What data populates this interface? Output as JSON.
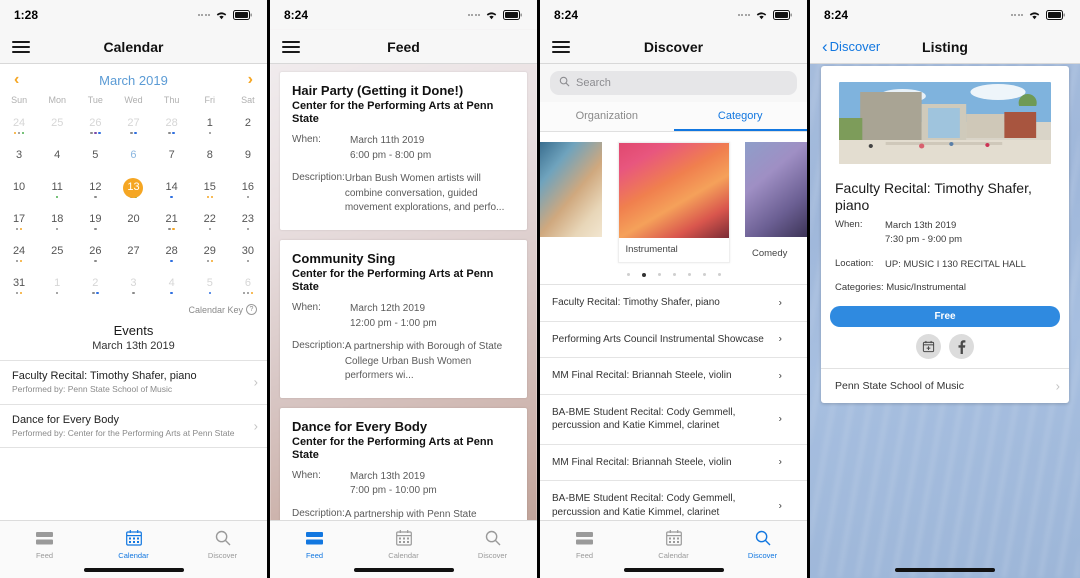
{
  "calendar_screen": {
    "status": {
      "time": "1:28"
    },
    "nav": {
      "title": "Calendar",
      "menu_icon": "hamburger-icon"
    },
    "month_label": "March 2019",
    "prev_icon": "chevron-left-icon",
    "next_icon": "chevron-right-icon",
    "weekdays": [
      "Sun",
      "Mon",
      "Tue",
      "Wed",
      "Thu",
      "Fri",
      "Sat"
    ],
    "days": [
      {
        "n": "24",
        "dim": true,
        "dots": [
          "#f5a623",
          "#8a8a8a",
          "#4caf50"
        ]
      },
      {
        "n": "25",
        "dim": true,
        "dots": []
      },
      {
        "n": "26",
        "dim": true,
        "dots": [
          "#8a8a8a",
          "#7b4ba8",
          "#2f6fe0"
        ]
      },
      {
        "n": "27",
        "dim": true,
        "dots": [
          "#8a8a8a",
          "#2f6fe0"
        ]
      },
      {
        "n": "28",
        "dim": true,
        "dots": [
          "#8a8a8a",
          "#2f6fe0"
        ]
      },
      {
        "n": "1",
        "dots": [
          "#8a8a8a"
        ]
      },
      {
        "n": "2",
        "dots": []
      },
      {
        "n": "3",
        "dots": []
      },
      {
        "n": "4",
        "dots": []
      },
      {
        "n": "5",
        "dots": []
      },
      {
        "n": "6",
        "blue": true,
        "dots": []
      },
      {
        "n": "7",
        "dots": []
      },
      {
        "n": "8",
        "dots": []
      },
      {
        "n": "9",
        "dots": []
      },
      {
        "n": "10",
        "dots": []
      },
      {
        "n": "11",
        "dots": [
          "#4caf50"
        ]
      },
      {
        "n": "12",
        "dots": [
          "#8a8a8a"
        ]
      },
      {
        "n": "13",
        "selected": true,
        "dots": [
          "#2f6fe0",
          "#4caf50"
        ]
      },
      {
        "n": "14",
        "dots": [
          "#2f6fe0"
        ]
      },
      {
        "n": "15",
        "dots": [
          "#f5a623",
          "#f5a623"
        ]
      },
      {
        "n": "16",
        "dots": [
          "#8a8a8a"
        ]
      },
      {
        "n": "17",
        "dots": [
          "#8a8a8a",
          "#f5a623"
        ]
      },
      {
        "n": "18",
        "dots": [
          "#8a8a8a"
        ]
      },
      {
        "n": "19",
        "dots": [
          "#8a8a8a"
        ]
      },
      {
        "n": "20",
        "dots": []
      },
      {
        "n": "21",
        "dots": [
          "#8a8a8a",
          "#f5a623"
        ]
      },
      {
        "n": "22",
        "dots": [
          "#8a8a8a"
        ]
      },
      {
        "n": "23",
        "dots": [
          "#8a8a8a"
        ]
      },
      {
        "n": "24",
        "dots": [
          "#8a8a8a",
          "#f5a623"
        ]
      },
      {
        "n": "25",
        "dots": []
      },
      {
        "n": "26",
        "dots": [
          "#8a8a8a"
        ]
      },
      {
        "n": "27",
        "dots": []
      },
      {
        "n": "28",
        "dots": [
          "#2f6fe0"
        ]
      },
      {
        "n": "29",
        "dots": [
          "#8a8a8a",
          "#f5a623"
        ]
      },
      {
        "n": "30",
        "dots": [
          "#8a8a8a"
        ]
      },
      {
        "n": "31",
        "dots": [
          "#8a8a8a",
          "#f5a623"
        ]
      },
      {
        "n": "1",
        "dim": true,
        "dots": [
          "#8a8a8a"
        ]
      },
      {
        "n": "2",
        "dim": true,
        "dots": [
          "#8a8a8a",
          "#2f6fe0"
        ]
      },
      {
        "n": "3",
        "dim": true,
        "dots": [
          "#8a8a8a"
        ]
      },
      {
        "n": "4",
        "dim": true,
        "dots": [
          "#2f6fe0"
        ]
      },
      {
        "n": "5",
        "dim": true,
        "dots": [
          "#2f6fe0"
        ]
      },
      {
        "n": "6",
        "dim": true,
        "dots": [
          "#8a8a8a",
          "#8a8a8a",
          "#f5a623"
        ]
      }
    ],
    "calendar_key": "Calendar Key",
    "events_header": "Events",
    "events_date": "March 13th 2019",
    "events": [
      {
        "title": "Faculty Recital: Timothy Shafer, piano",
        "subtitle": "Performed by: Penn State School of Music"
      },
      {
        "title": "Dance for Every Body",
        "subtitle": "Performed by: Center for the Performing Arts at Penn State"
      }
    ],
    "tabs": [
      {
        "label": "Feed",
        "icon": "feed-icon",
        "active": false
      },
      {
        "label": "Calendar",
        "icon": "calendar-icon",
        "active": true
      },
      {
        "label": "Discover",
        "icon": "search-icon",
        "active": false
      }
    ]
  },
  "feed_screen": {
    "status": {
      "time": "8:24"
    },
    "nav": {
      "title": "Feed",
      "menu_icon": "hamburger-icon"
    },
    "when_label": "When:",
    "desc_label": "Description:",
    "cards": [
      {
        "title": "Hair Party (Getting it Done!)",
        "org": "Center for the Performing Arts at Penn State",
        "date": "March 11th 2019",
        "time": "6:00 pm - 8:00 pm",
        "description": "Urban Bush Women artists will combine conversation, guided movement explorations, and perfo..."
      },
      {
        "title": "Community Sing",
        "org": "Center for the Performing Arts at Penn State",
        "date": "March 12th 2019",
        "time": "12:00 pm - 1:00 pm",
        "description": "A partnership with Borough of State College Urban Bush Women performers wi..."
      },
      {
        "title": "Dance for Every Body",
        "org": "Center for the Performing Arts at Penn State",
        "date": "March 13th 2019",
        "time": "7:00 pm - 10:00 pm",
        "description": "A partnership with Penn State"
      }
    ],
    "tabs": [
      {
        "label": "Feed",
        "icon": "feed-icon",
        "active": true
      },
      {
        "label": "Calendar",
        "icon": "calendar-icon",
        "active": false
      },
      {
        "label": "Discover",
        "icon": "search-icon",
        "active": false
      }
    ]
  },
  "discover_screen": {
    "status": {
      "time": "8:24"
    },
    "nav": {
      "title": "Discover",
      "menu_icon": "hamburger-icon"
    },
    "search": {
      "placeholder": "Search",
      "icon": "search-icon"
    },
    "segments": [
      {
        "label": "Organization",
        "active": false
      },
      {
        "label": "Category",
        "active": true
      }
    ],
    "carousel": {
      "center_label": "Instrumental",
      "right_label": "Comedy",
      "page_count": 7,
      "active_page": 2
    },
    "list": [
      "Faculty Recital: Timothy Shafer, piano",
      "Performing Arts Council Instrumental Showcase",
      "MM Final Recital: Briannah Steele, violin",
      "BA-BME Student Recital: Cody Gemmell, percussion and Katie Kimmel, clarinet",
      "MM Final Recital: Briannah Steele, violin",
      "BA-BME Student Recital: Cody Gemmell, percussion and Katie Kimmel, clarinet"
    ],
    "tabs": [
      {
        "label": "Feed",
        "icon": "feed-icon",
        "active": false
      },
      {
        "label": "Calendar",
        "icon": "calendar-icon",
        "active": false
      },
      {
        "label": "Discover",
        "icon": "search-icon",
        "active": true
      }
    ]
  },
  "listing_screen": {
    "status": {
      "time": "8:24"
    },
    "nav": {
      "back_label": "Discover",
      "title": "Listing",
      "back_icon": "chevron-left-icon"
    },
    "title": "Faculty Recital: Timothy Shafer, piano",
    "when_label": "When:",
    "date": "March 13th 2019",
    "time": "7:30 pm - 9:00 pm",
    "location_label": "Location:",
    "location": "UP: MUSIC I 130 RECITAL HALL",
    "categories": "Categories: Music/Instrumental",
    "price_button": "Free",
    "social": [
      {
        "icon": "calendar-add-icon"
      },
      {
        "icon": "facebook-icon"
      }
    ],
    "footer_link": "Penn State School of Music",
    "accent_color": "#2f8ae0"
  }
}
